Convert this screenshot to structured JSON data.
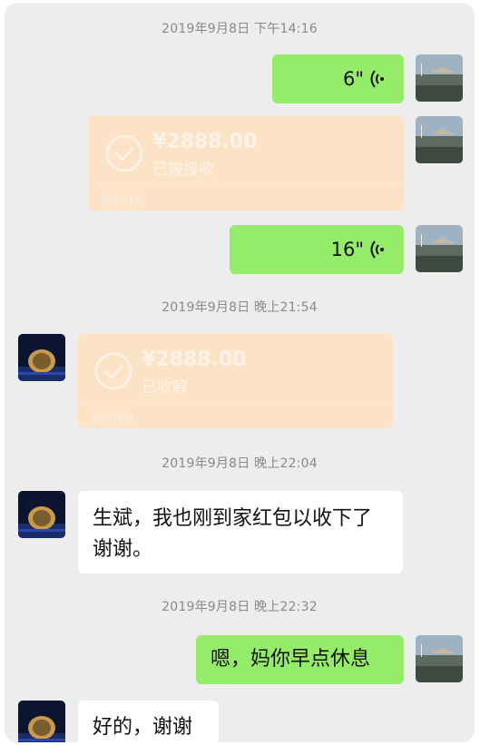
{
  "messages": {
    "ts1": "2019年9月8日 下午14:16",
    "voice1": {
      "duration": "6\""
    },
    "transfer1": {
      "amount": "¥2888.00",
      "status": "已被接收",
      "footer": "微信转账"
    },
    "voice2": {
      "duration": "16\""
    },
    "ts2": "2019年9月8日 晚上21:54",
    "transfer2": {
      "amount": "¥2888.00",
      "status": "已收款",
      "footer": "微信转账"
    },
    "ts3": "2019年9月8日 晚上22:04",
    "text1": "生斌，我也刚到家红包以收下了谢谢。",
    "ts4": "2019年9月8日 晚上22:32",
    "text2": "嗯，妈你早点休息",
    "text3": "好的，谢谢"
  },
  "colors": {
    "chat_bg": "#ededed",
    "sent_bubble": "#95ec69",
    "received_bubble": "#ffffff",
    "transfer_bg": "#fde3c6"
  },
  "icons": {
    "voice": "voice-wave-icon",
    "transfer_done": "check-circle-icon"
  }
}
